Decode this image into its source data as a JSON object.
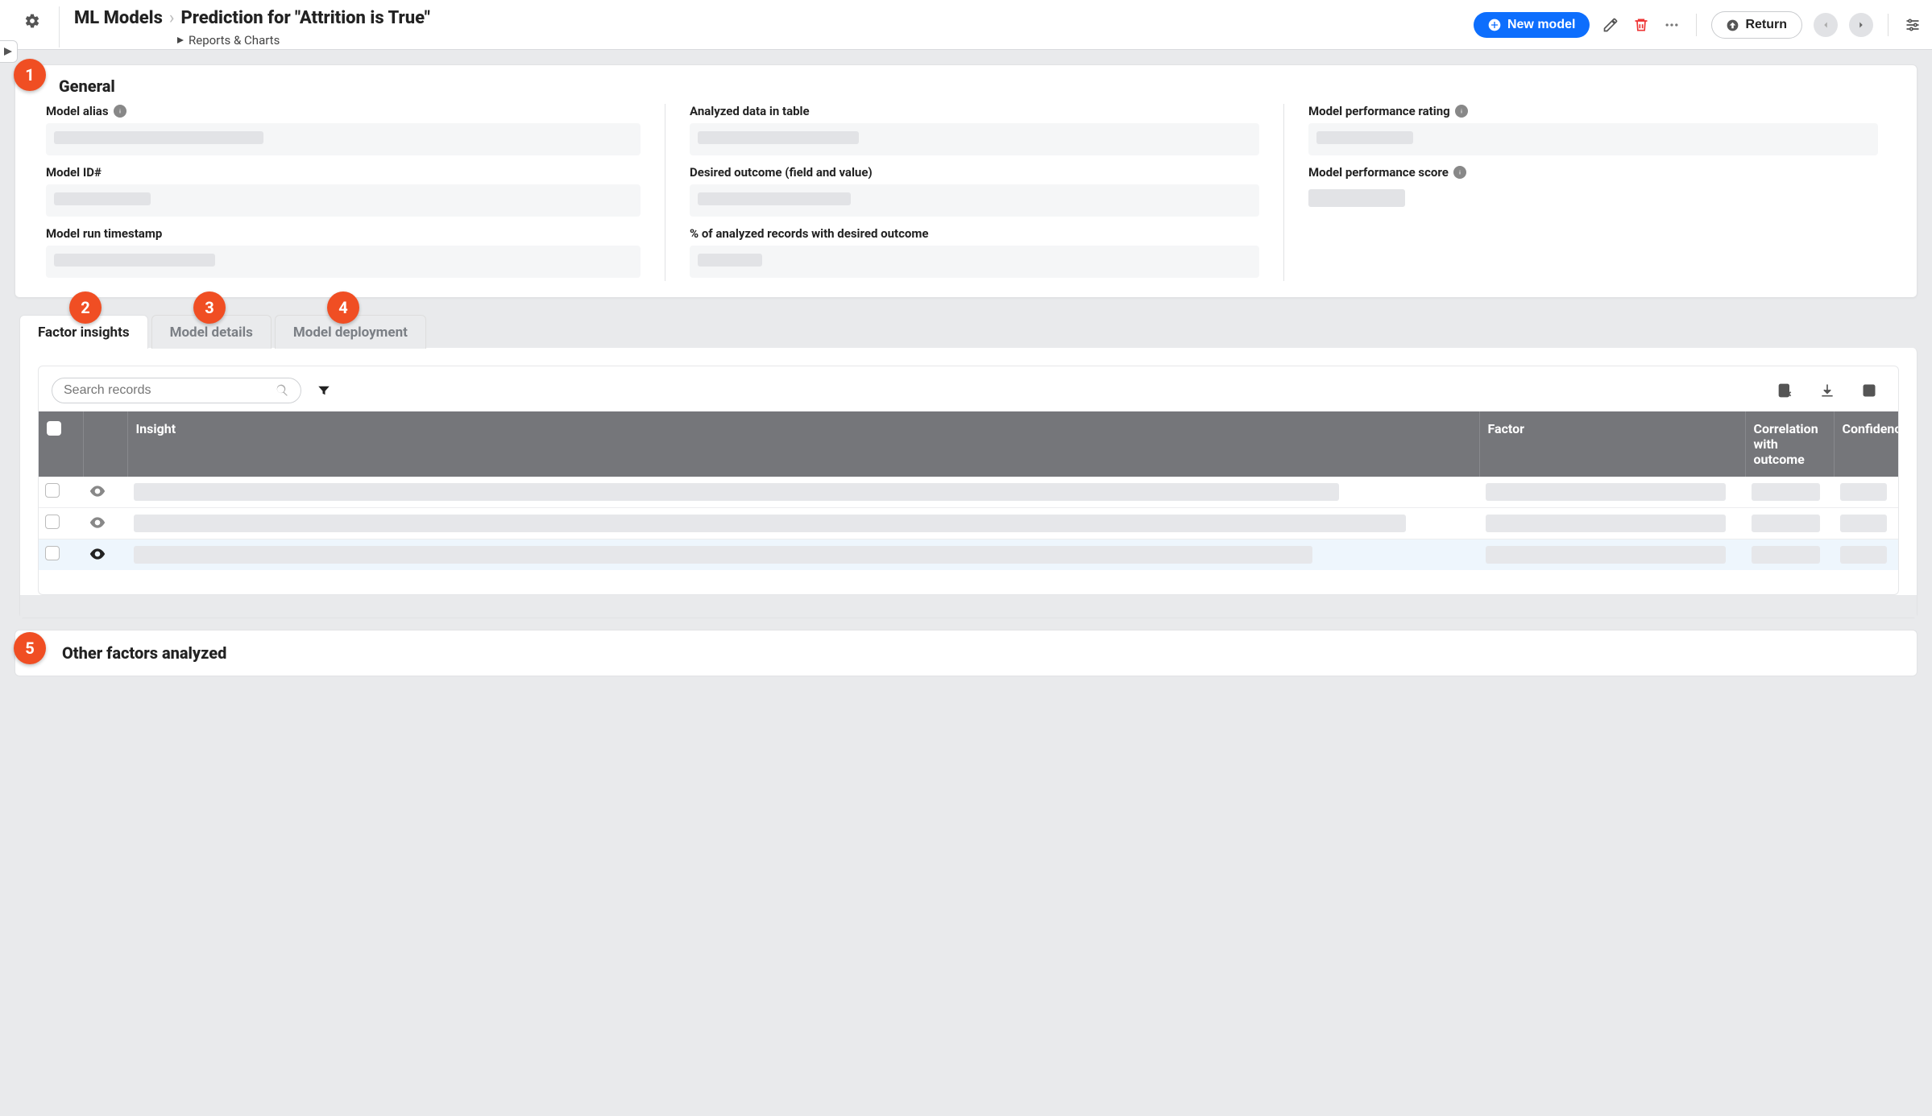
{
  "header": {
    "breadcrumb_parent": "ML Models",
    "breadcrumb_current": "Prediction for \"Attrition is True\"",
    "sub_breadcrumb": "Reports & Charts",
    "new_model_label": "New model",
    "return_label": "Return"
  },
  "callouts": {
    "c1": "1",
    "c2": "2",
    "c3": "3",
    "c4": "4",
    "c5": "5"
  },
  "general": {
    "section_title": "General",
    "col1": {
      "model_alias_label": "Model alias",
      "model_id_label": "Model ID#",
      "model_run_ts_label": "Model run timestamp"
    },
    "col2": {
      "analyzed_table_label": "Analyzed data in table",
      "desired_outcome_label": "Desired outcome (field and value)",
      "pct_desired_label": "% of analyzed records with desired outcome"
    },
    "col3": {
      "perf_rating_label": "Model performance rating",
      "perf_score_label": "Model performance score"
    }
  },
  "tabs": {
    "factor_insights": "Factor insights",
    "model_details": "Model details",
    "model_deployment": "Model deployment"
  },
  "table": {
    "search_placeholder": "Search records",
    "columns": {
      "insight": "Insight",
      "factor": "Factor",
      "correlation": "Correlation with outcome",
      "confidence": "Confidence"
    }
  },
  "other_factors": {
    "section_title": "Other factors analyzed"
  }
}
